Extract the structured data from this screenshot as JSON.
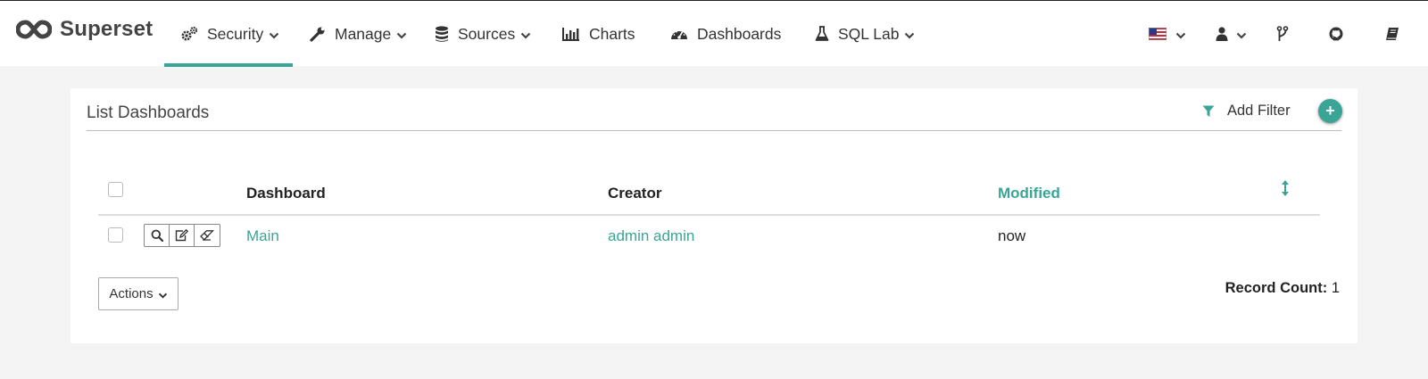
{
  "brand": {
    "name": "Superset",
    "logo_icon": "infinity-logo-icon"
  },
  "nav": {
    "security": {
      "label": "Security",
      "icon": "gears-icon"
    },
    "manage": {
      "label": "Manage",
      "icon": "wrench-icon"
    },
    "sources": {
      "label": "Sources",
      "icon": "database-icon"
    },
    "charts": {
      "label": "Charts",
      "icon": "bar-chart-icon"
    },
    "dashboards": {
      "label": "Dashboards",
      "icon": "dashboard-gauge-icon"
    },
    "sqllab": {
      "label": "SQL Lab",
      "icon": "flask-icon"
    }
  },
  "nav_right": [
    "us-flag-icon",
    "user-icon",
    "code-branch-icon",
    "github-icon",
    "book-icon"
  ],
  "panel": {
    "title": "List Dashboards",
    "add_filter_label": "Add Filter",
    "add_button": "+"
  },
  "table": {
    "headers": {
      "dashboard": "Dashboard",
      "creator": "Creator",
      "modified": "Modified"
    },
    "rows": [
      {
        "dashboard": "Main",
        "creator": "admin admin",
        "modified": "now",
        "actions": [
          "search-icon",
          "edit-icon",
          "eraser-icon"
        ]
      }
    ]
  },
  "footer": {
    "actions_label": "Actions",
    "record_count_label": "Record Count:",
    "record_count_value": "1"
  },
  "colors": {
    "accent": "#3aa597",
    "background": "#f4f4f4",
    "text": "#333333"
  }
}
